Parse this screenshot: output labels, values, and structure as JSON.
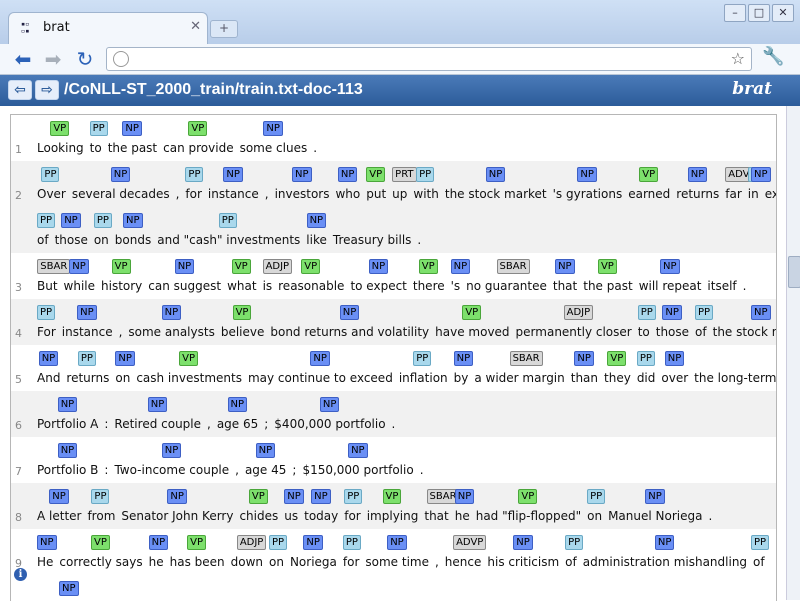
{
  "browser": {
    "tab_title": "brat",
    "tab_favicon": "brat-favicon",
    "url": "",
    "icons": [
      "back-arrow-icon",
      "forward-arrow-icon",
      "reload-icon",
      "globe-icon",
      "star-icon",
      "wrench-icon",
      "new-tab-icon",
      "close-icon",
      "minimize-icon",
      "maximize-icon"
    ]
  },
  "brat": {
    "doc_path": "/CoNLL-ST_2000_train/train.txt-doc-113",
    "logo": "brat",
    "label_colors": {
      "NP": "#6a8ff5",
      "PP": "#a9d8ec",
      "VP": "#7de06c",
      "ADVP": "#d8d8d8",
      "ADJP": "#d8d8d8",
      "SBAR": "#d8d8d8",
      "PRT": "#d8d8d8"
    }
  },
  "sentences": [
    {
      "num": "1",
      "rows": [
        {
          "tokens": [
            "Looking",
            "to",
            "the past",
            "can provide",
            "some clues",
            "."
          ],
          "labels": [
            "VP",
            "PP",
            "NP",
            "VP",
            "NP"
          ]
        }
      ]
    },
    {
      "num": "2",
      "rows": [
        {
          "tokens": [
            "Over",
            "several decades",
            ",",
            "for",
            "instance",
            ",",
            "investors",
            "who",
            "put",
            "up",
            "with",
            "the stock market",
            "'s gyrations",
            "earned",
            "returns",
            "far",
            "in",
            "excess"
          ],
          "labels": [
            "PP",
            "NP",
            "PP",
            "NP",
            "NP",
            "NP",
            "VP",
            "PRT",
            "PP",
            "NP",
            "NP",
            "VP",
            "NP",
            "ADVP",
            "PP",
            "NP"
          ]
        },
        {
          "tokens": [
            "of",
            "those",
            "on",
            "bonds",
            "and \"cash\" investments",
            "like",
            "Treasury bills",
            "."
          ],
          "labels": [
            "PP",
            "NP",
            "PP",
            "NP",
            "PP",
            "NP"
          ]
        }
      ]
    },
    {
      "num": "3",
      "rows": [
        {
          "tokens": [
            "But",
            "while",
            "history",
            "can suggest",
            "what",
            "is",
            "reasonable",
            "to expect",
            "there",
            "'s",
            "no guarantee",
            "that",
            "the past",
            "will repeat",
            "itself",
            "."
          ],
          "labels": [
            "SBAR",
            "NP",
            "VP",
            "NP",
            "VP",
            "ADJP",
            "VP",
            "NP",
            "VP",
            "NP",
            "SBAR",
            "NP",
            "VP",
            "NP"
          ]
        }
      ]
    },
    {
      "num": "4",
      "rows": [
        {
          "tokens": [
            "For",
            "instance",
            ",",
            "some analysts",
            "believe",
            "bond returns and volatility",
            "have moved",
            "permanently closer",
            "to",
            "those",
            "of",
            "the stock market",
            "."
          ],
          "labels": [
            "PP",
            "NP",
            "NP",
            "VP",
            "NP",
            "VP",
            "ADJP",
            "PP",
            "NP",
            "PP",
            "NP"
          ]
        }
      ]
    },
    {
      "num": "5",
      "rows": [
        {
          "tokens": [
            "And",
            "returns",
            "on",
            "cash investments",
            "may continue to exceed",
            "inflation",
            "by",
            "a wider margin",
            "than",
            "they",
            "did",
            "over",
            "the long-term past",
            "."
          ],
          "labels": [
            "NP",
            "PP",
            "NP",
            "VP",
            "NP",
            "PP",
            "NP",
            "SBAR",
            "NP",
            "VP",
            "PP",
            "NP"
          ]
        }
      ]
    },
    {
      "num": "6",
      "rows": [
        {
          "tokens": [
            "Portfolio A",
            ":",
            "Retired couple",
            ",",
            "age 65",
            ";",
            "$400,000 portfolio",
            "."
          ],
          "labels": [
            "NP",
            "NP",
            "NP",
            "NP"
          ]
        }
      ]
    },
    {
      "num": "7",
      "rows": [
        {
          "tokens": [
            "Portfolio B",
            ":",
            "Two-income couple",
            ",",
            "age 45",
            ";",
            "$150,000 portfolio",
            "."
          ],
          "labels": [
            "NP",
            "NP",
            "NP",
            "NP"
          ]
        }
      ]
    },
    {
      "num": "8",
      "rows": [
        {
          "tokens": [
            "A letter",
            "from",
            "Senator John Kerry",
            "chides",
            "us",
            "today",
            "for",
            "implying",
            "that",
            "he",
            "had \"flip-flopped\"",
            "on",
            "Manuel Noriega",
            "."
          ],
          "labels": [
            "NP",
            "PP",
            "NP",
            "VP",
            "NP",
            "NP",
            "PP",
            "VP",
            "SBAR",
            "NP",
            "VP",
            "PP",
            "NP"
          ]
        }
      ]
    },
    {
      "num": "9",
      "rows": [
        {
          "tokens": [
            "He",
            "correctly says",
            "he",
            "has been",
            "down",
            "on",
            "Noriega",
            "for",
            "some time",
            ",",
            "hence",
            "his criticism",
            "of",
            "administration mishandling",
            "of"
          ],
          "labels": [
            "NP",
            "VP",
            "NP",
            "VP",
            "ADJP",
            "PP",
            "NP",
            "PP",
            "NP",
            "ADVP",
            "NP",
            "PP",
            "NP",
            "PP"
          ]
        },
        {
          "tokens": [],
          "labels": [
            "NP"
          ]
        }
      ]
    }
  ]
}
